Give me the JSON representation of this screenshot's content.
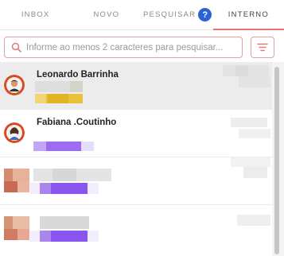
{
  "tabs": [
    {
      "label": "INBOX",
      "active": false
    },
    {
      "label": "NOVO",
      "active": false
    },
    {
      "label": "PESQUISAR",
      "active": false,
      "badge": "?"
    },
    {
      "label": "INTERNO",
      "active": true
    }
  ],
  "search": {
    "placeholder": "Informe ao menos 2 caracteres para pesquisar...",
    "value": "",
    "icon": "search-icon"
  },
  "filter_button": {
    "icon": "filter-icon"
  },
  "contacts": [
    {
      "name": "Leonardo Barrinha",
      "selected": true,
      "avatar": "avatar-photo",
      "tag_color": "#e8c33a"
    },
    {
      "name": "Fabiana .Coutinho",
      "selected": false,
      "avatar": "avatar-photo",
      "tag_color": "#9b6cf0"
    },
    {
      "name": "",
      "selected": false,
      "avatar": "avatar-blurred",
      "tag_color": "#8a55ee"
    },
    {
      "name": "",
      "selected": false,
      "avatar": "avatar-blurred",
      "tag_color": "#8a55ee"
    }
  ],
  "colors": {
    "accent": "#e57373",
    "help_badge": "#2a63d4",
    "selected_row": "#ececec"
  }
}
